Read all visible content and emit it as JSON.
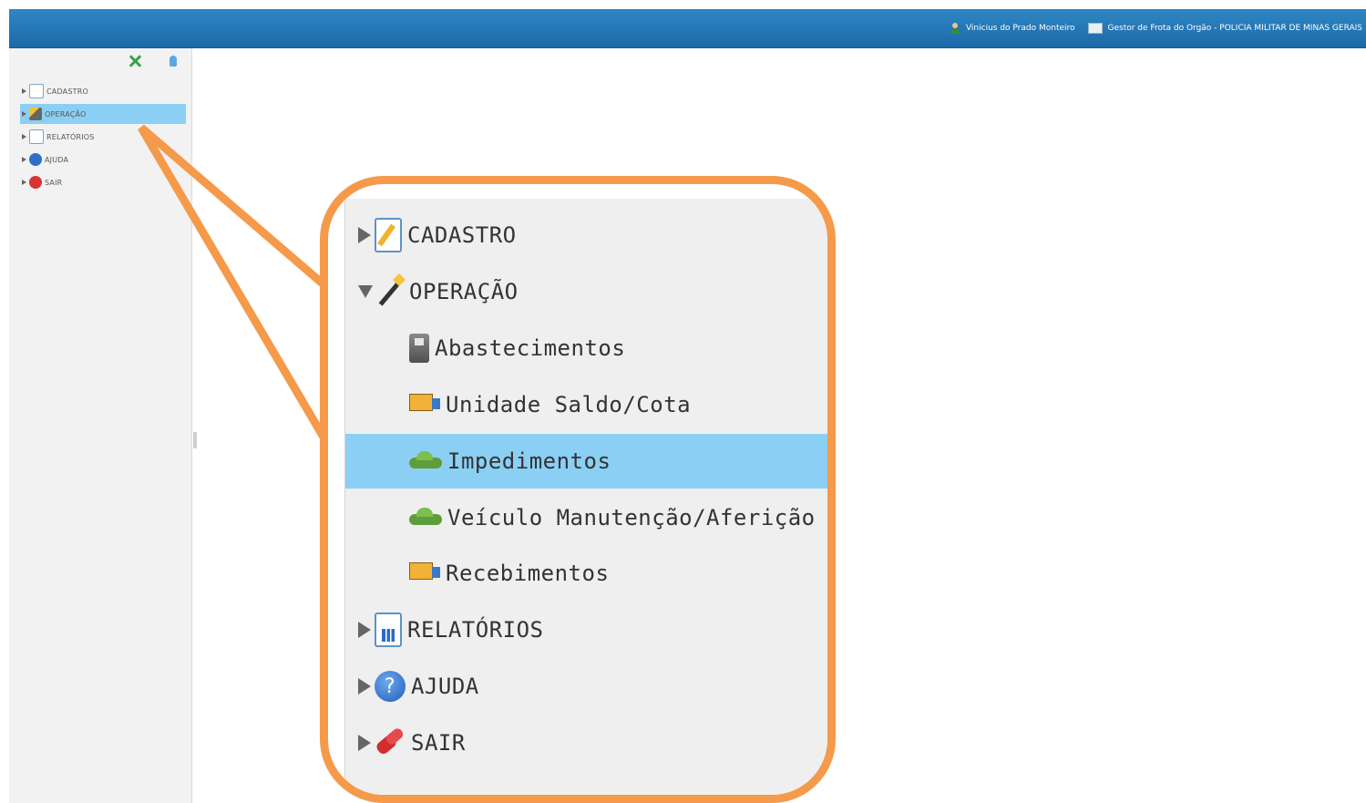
{
  "header": {
    "user_name": "Vinicius do Prado Monteiro",
    "role": "Gestor de Frota do Orgão - POLICIA MILITAR DE MINAS GERAIS",
    "user_icon": "user-icon",
    "role_icon": "id-card-icon"
  },
  "sidebar": {
    "items": [
      {
        "label": "CADASTRO",
        "icon": "pencil-document-icon",
        "selected": false
      },
      {
        "label": "OPERAÇÃO",
        "icon": "magic-wand-icon",
        "selected": true
      },
      {
        "label": "RELATÓRIOS",
        "icon": "report-chart-icon",
        "selected": false
      },
      {
        "label": "AJUDA",
        "icon": "help-icon",
        "selected": false
      },
      {
        "label": "SAIR",
        "icon": "exit-plug-icon",
        "selected": false
      }
    ]
  },
  "zoom_menu": {
    "items": [
      {
        "label": "CADASTRO",
        "expanded": false
      },
      {
        "label": "OPERAÇÃO",
        "expanded": true
      },
      {
        "label": "RELATÓRIOS",
        "expanded": false
      },
      {
        "label": "AJUDA",
        "expanded": false
      },
      {
        "label": "SAIR",
        "expanded": false
      }
    ],
    "operacao_children": [
      {
        "label": "Abastecimentos",
        "icon": "fuel-pump-icon",
        "selected": false
      },
      {
        "label": "Unidade Saldo/Cota",
        "icon": "truck-icon",
        "selected": false
      },
      {
        "label": "Impedimentos",
        "icon": "car-icon",
        "selected": true
      },
      {
        "label": "Veículo Manutenção/Aferição",
        "icon": "car-icon",
        "selected": false
      },
      {
        "label": "Recebimentos",
        "icon": "truck-icon",
        "selected": false
      }
    ]
  },
  "colors": {
    "header_blue": "#1c6aa8",
    "selection_blue": "#8ccff5",
    "callout_orange": "#f59a4a"
  }
}
